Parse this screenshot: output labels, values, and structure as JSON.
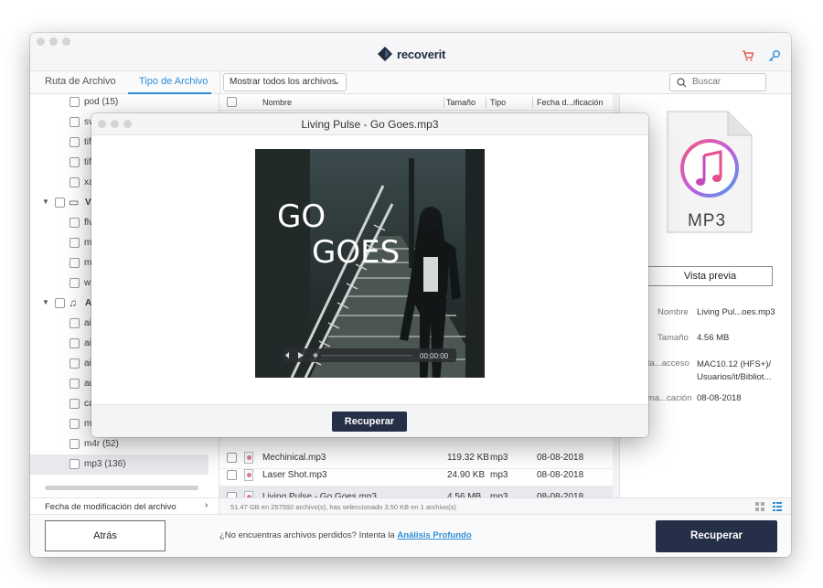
{
  "app": {
    "brand": "recoverit"
  },
  "tabs": [
    {
      "label": "Ruta de Archivo"
    },
    {
      "label": "Tipo de Archivo"
    }
  ],
  "filter": {
    "label": "Mostrar todos los archivos"
  },
  "search": {
    "placeholder": "Buscar"
  },
  "tree": {
    "rows": [
      {
        "label": "pod (15)"
      },
      {
        "label": "sv"
      },
      {
        "label": "tif"
      },
      {
        "label": "tif"
      },
      {
        "label": "xa"
      },
      {
        "label": "V"
      },
      {
        "label": "flv"
      },
      {
        "label": "m"
      },
      {
        "label": "m"
      },
      {
        "label": "w"
      },
      {
        "label": "A"
      },
      {
        "label": "ai"
      },
      {
        "label": "ai"
      },
      {
        "label": "ai"
      },
      {
        "label": "au"
      },
      {
        "label": "ca"
      },
      {
        "label": "m"
      },
      {
        "label": "m4r (52)"
      },
      {
        "label": "mp3 (136)"
      }
    ],
    "footer": "Fecha de modificación del archivo"
  },
  "columns": {
    "name": "Nombre",
    "size": "Tamaño",
    "type": "Tipo",
    "date": "Fecha d...ificación"
  },
  "files": [
    {
      "name": "Laser Shot.mp3",
      "size": "24.90 KB",
      "type": "mp3",
      "date": "08-08-2018"
    },
    {
      "name": "Living Pulse - Go Goes.mp3",
      "size": "4.56 MB",
      "type": "mp3",
      "date": "08-08-2018"
    },
    {
      "name": "Mechinical.mp3",
      "size": "119.32 KB",
      "type": "mp3",
      "date": "08-08-2018"
    }
  ],
  "status": "51.47 GB en 257592 archivo(s), has seleccionado 3.50 KB en 1 archivo(s)",
  "preview": {
    "icon_label": "MP3",
    "button": "Vista previa",
    "props": [
      {
        "key": "Nombre",
        "value": "Living Pul...oes.mp3"
      },
      {
        "key": "Tamaño",
        "value": "4.56 MB"
      },
      {
        "key": "...ta...acceso",
        "value": "MAC10.12 (HFS+)/ Usuarios/it/Bibliot..."
      },
      {
        "key": "...ma...cación",
        "value": "08-08-2018"
      }
    ]
  },
  "bottom": {
    "back": "Atrás",
    "prompt": "¿No encuentras archivos perdidos? Intenta la",
    "link": "Análisis Profundo",
    "recover": "Recuperar"
  },
  "modal": {
    "title": "Living Pulse - Go Goes.mp3",
    "cover_line1": "GO",
    "cover_line2": "GOES",
    "time": "00:00:00",
    "recover": "Recuperar"
  },
  "colors": {
    "accent": "#2e8ed8",
    "primary_button": "#253048"
  }
}
